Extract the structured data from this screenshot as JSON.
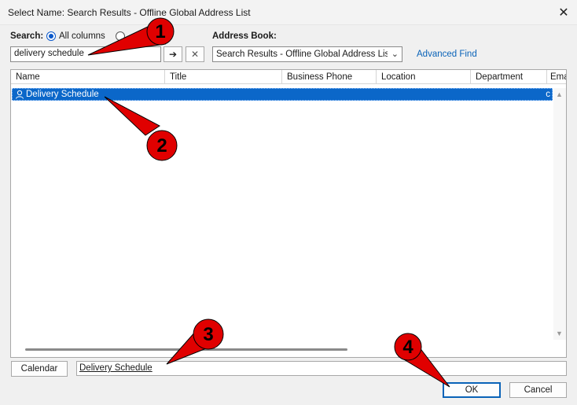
{
  "window": {
    "title": "Select Name: Search Results - Offline Global Address List",
    "close_glyph": "✕"
  },
  "search": {
    "label": "Search:",
    "option_all": "All columns",
    "value": "delivery schedule",
    "go_glyph": "➔",
    "clear_glyph": "✕"
  },
  "address_book": {
    "label": "Address Book:",
    "selected": "Search Results - Offline Global Address List",
    "advanced_find": "Advanced Find"
  },
  "table": {
    "columns": [
      "Name",
      "Title",
      "Business Phone",
      "Location",
      "Department",
      "Ema"
    ],
    "rows": [
      {
        "name": "Delivery Schedule",
        "email_trunc": "c"
      }
    ]
  },
  "bottom": {
    "calendar_label": "Calendar",
    "to_value": "Delivery Schedule",
    "ok_label": "OK",
    "cancel_label": "Cancel"
  },
  "annotations": {
    "labels": [
      "1",
      "2",
      "3",
      "4"
    ],
    "color": "#e00000"
  },
  "colors": {
    "selection": "#0b67c9",
    "accent": "#0a63b8"
  }
}
